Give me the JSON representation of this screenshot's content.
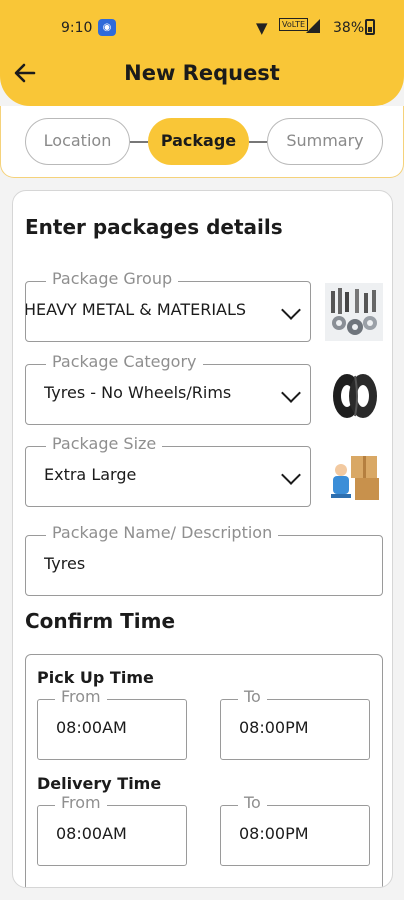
{
  "status_bar": {
    "time": "9:10",
    "volte": "VoLTE",
    "battery": "38%"
  },
  "header": {
    "title": "New Request",
    "back_icon": "arrow-left-icon",
    "accent_color": "#f9c637"
  },
  "stepper": {
    "steps": [
      {
        "label": "Location",
        "active": false
      },
      {
        "label": "Package",
        "active": true
      },
      {
        "label": "Summary",
        "active": false
      }
    ]
  },
  "package_section": {
    "title": "Enter packages details",
    "group": {
      "label": "Package Group",
      "value": "HEAVY METAL & MATERIALS",
      "thumb": "metal-parts-image"
    },
    "category": {
      "label": "Package Category",
      "value": "Tyres - No Wheels/Rims",
      "thumb": "tyres-image"
    },
    "size": {
      "label": "Package Size",
      "value": "Extra Large",
      "thumb": "delivery-boxes-image"
    },
    "name": {
      "label": "Package Name/ Description",
      "value": "Tyres"
    }
  },
  "time_section": {
    "title": "Confirm Time",
    "pickup": {
      "label": "Pick Up Time",
      "from_label": "From",
      "from_value": "08:00AM",
      "to_label": "To",
      "to_value": "08:00PM"
    },
    "delivery": {
      "label": "Delivery Time",
      "from_label": "From",
      "from_value": "08:00AM",
      "to_label": "To",
      "to_value": "08:00PM"
    }
  }
}
